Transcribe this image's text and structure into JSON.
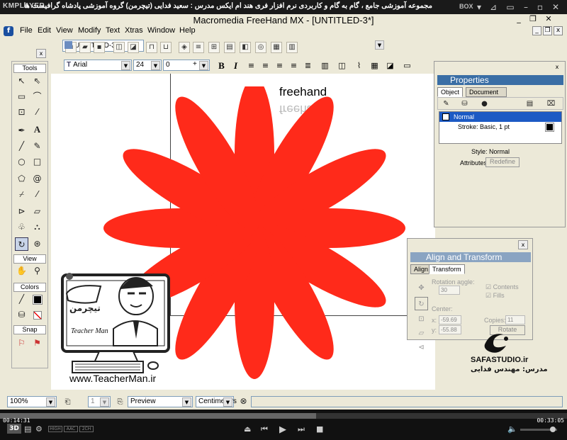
{
  "player": {
    "logo": "KMPLAYER",
    "title": "مجموعه آموزشی جامع ، گام به گام و کاربردی نرم افزار فری هند ام ایکس   مدرس : سعید فدایی (تیچرمن) گروه آموزشی پادشاه گرافیست ها",
    "box_label": "BOX",
    "current_time": "00:14:31",
    "total_time": "00:33:05",
    "progress": 0.557,
    "badges": [
      "3D",
      "HIGH",
      "AAC",
      "2CH"
    ]
  },
  "app": {
    "title": "Macromedia FreeHand MX - [UNTITLED-3*]",
    "menu": [
      "File",
      "Edit",
      "View",
      "Modify",
      "Text",
      "Xtras",
      "Window",
      "Help"
    ],
    "document_select": "UNTITLED-3",
    "font_name": "Arial",
    "font_size": "24",
    "leading": "0"
  },
  "canvas": {
    "text": "freehand",
    "star_color": "#ff2a1a"
  },
  "tools_panel": {
    "title": "Tools",
    "view_label": "View",
    "colors_label": "Colors",
    "snap_label": "Snap",
    "close": "x"
  },
  "properties": {
    "title": "Properties",
    "tabs": [
      "Object",
      "Document"
    ],
    "item_normal": "Normal",
    "item_stroke": "Stroke: Basic, 1 pt",
    "style_label": "Style: Normal",
    "attributes_label": "Attributes:",
    "redefine_button": "Redefine",
    "close": "x"
  },
  "align_transform": {
    "title": "Align and Transform",
    "tabs": [
      "Align",
      "Transform"
    ],
    "rotation_label": "Rotation angle:",
    "rotation_value": "30",
    "degree": "°",
    "contents_label": "Contents",
    "fills_label": "Fills",
    "center_label": "Center:",
    "x_label": "x:",
    "x_value": "-59.69",
    "y_label": "y:",
    "y_value": "-55.88",
    "copies_label": "Copies:",
    "copies_value": "11",
    "rotate_button": "Rotate",
    "close": "x"
  },
  "status": {
    "zoom": "100%",
    "page": "1",
    "view_mode": "Preview",
    "units": "Centimeters"
  },
  "overlay": {
    "teacher_bubble": "تیچرمن",
    "teacher_name": "Teacher Man",
    "teacher_url": "www.TeacherMan.ir",
    "safa_brand": "SAFASTUDIO.ir",
    "safa_teacher": "مدرس: مهندس فدایی"
  }
}
